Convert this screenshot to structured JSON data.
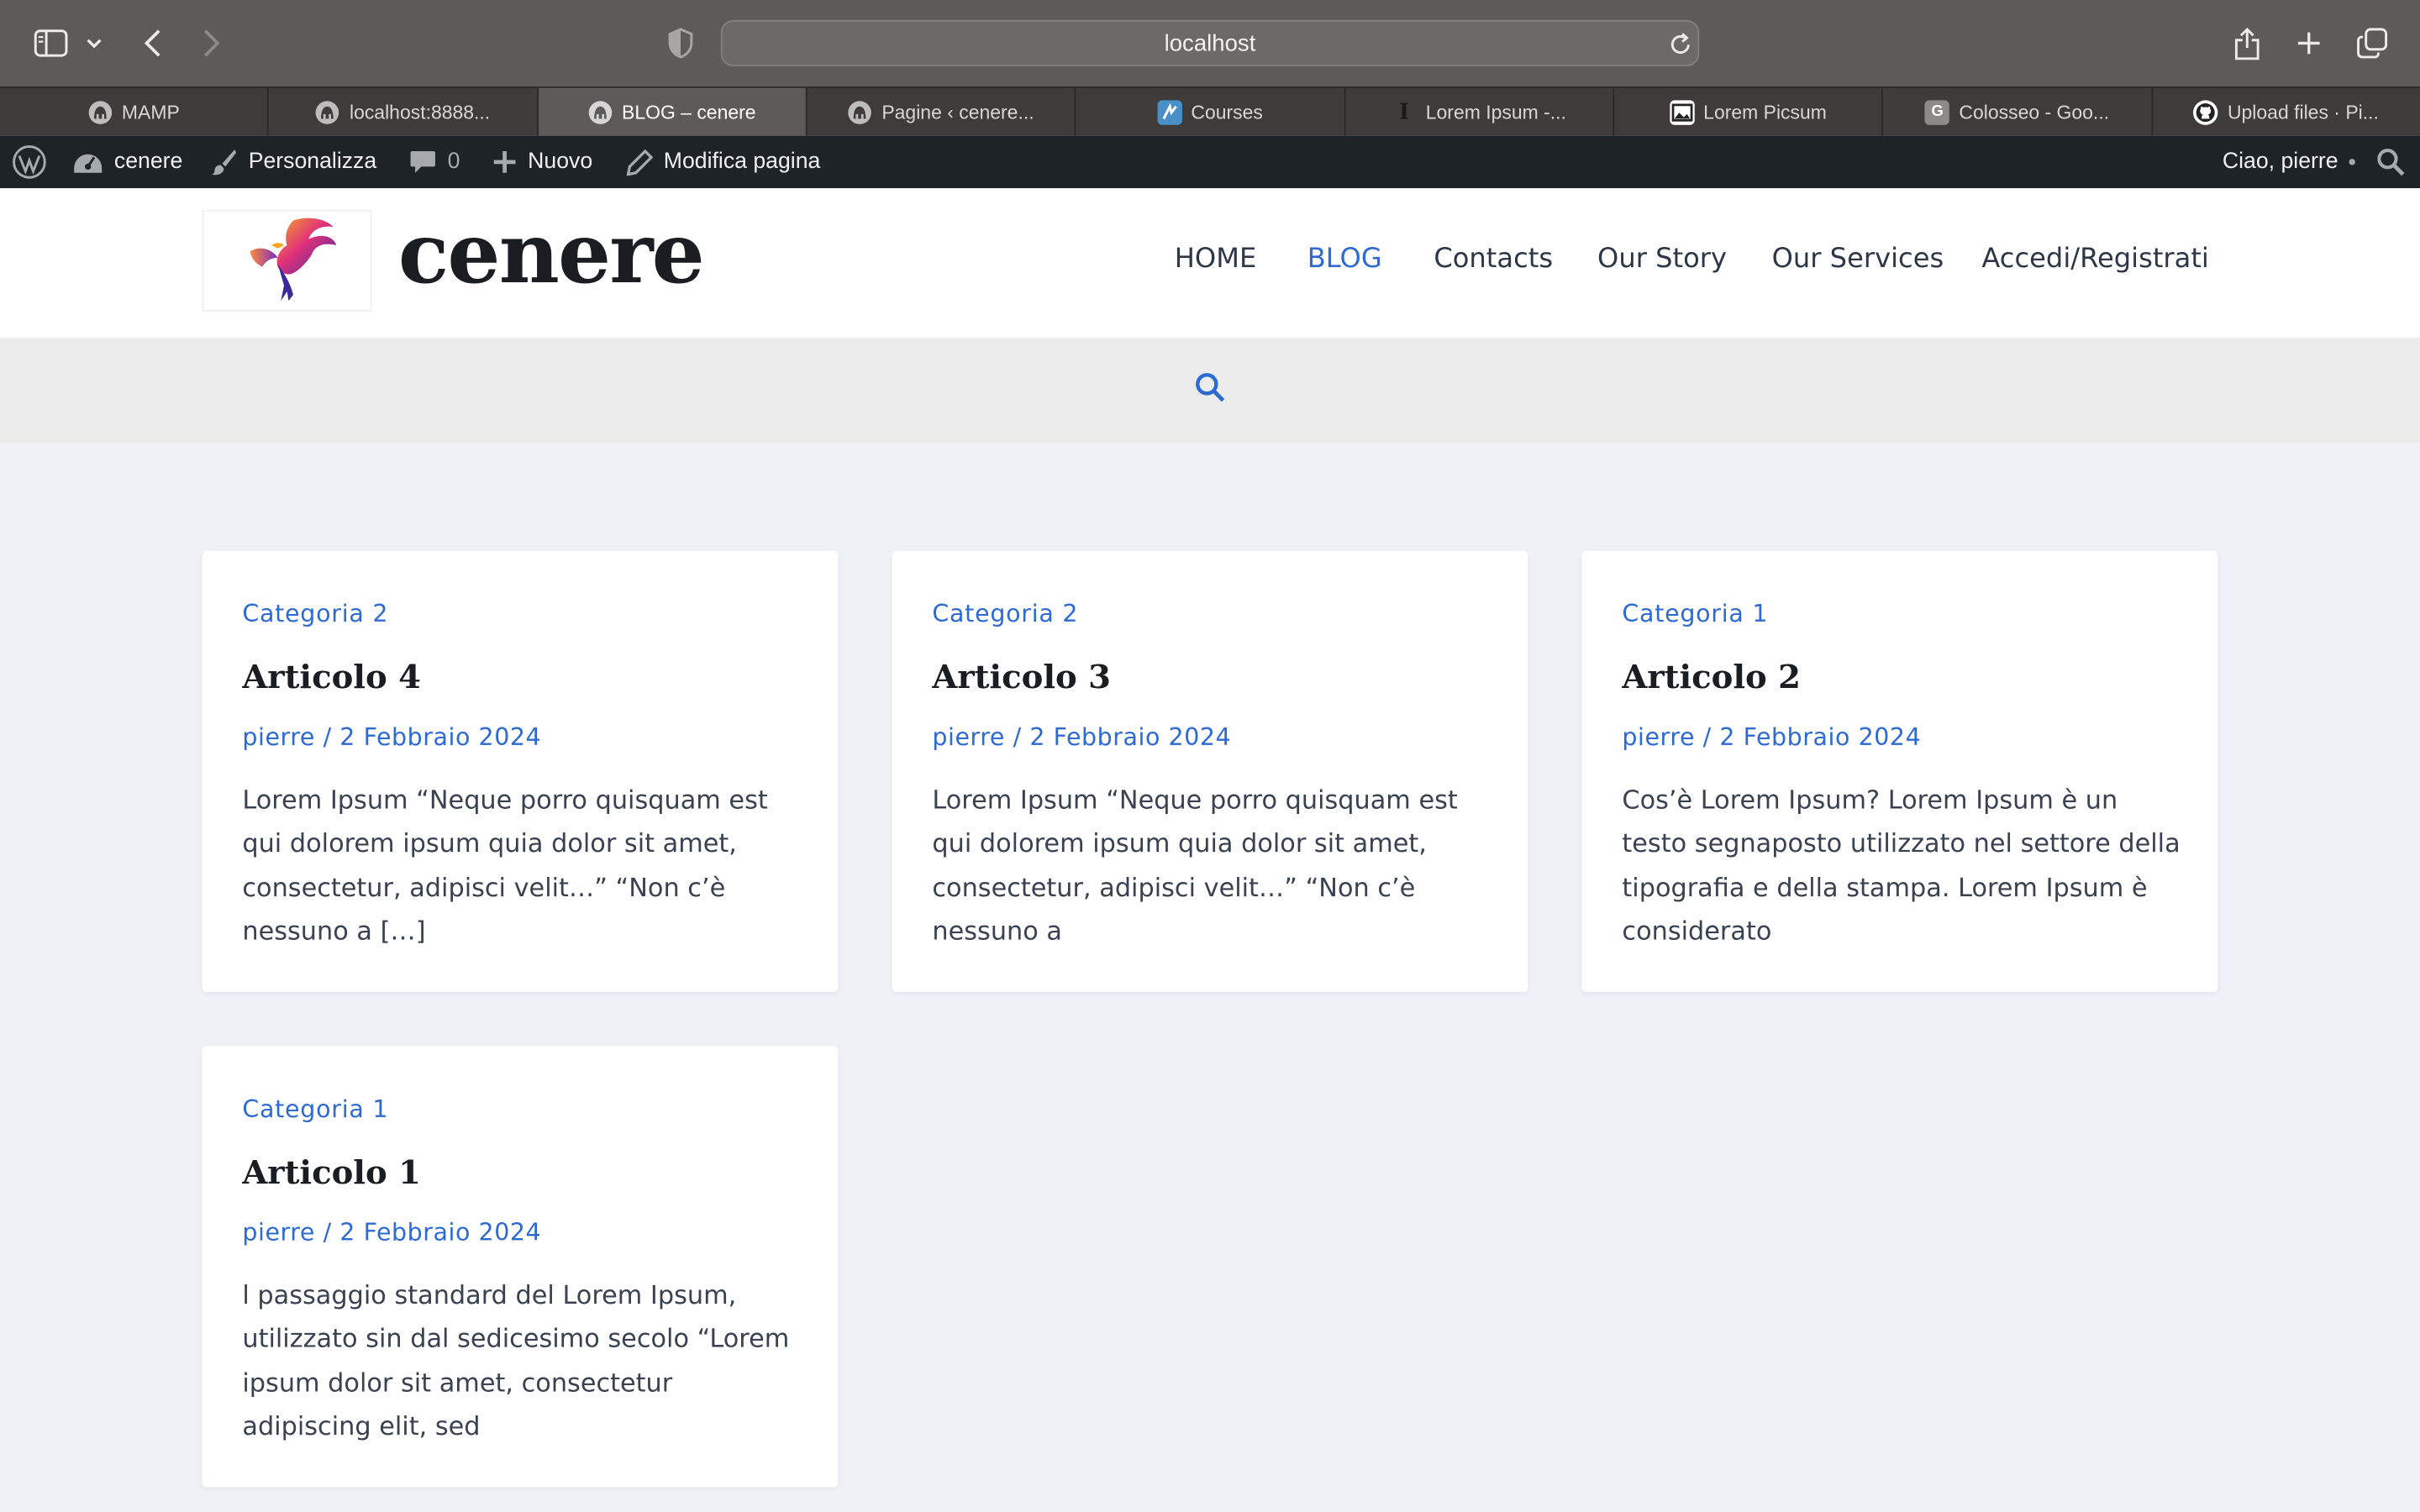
{
  "browser": {
    "url": "localhost",
    "tabs": [
      {
        "label": "MAMP",
        "icon": "mamp-elephant-icon",
        "active": false
      },
      {
        "label": "localhost:8888...",
        "icon": "mamp-elephant-icon",
        "active": false
      },
      {
        "label": "BLOG – cenere",
        "icon": "mamp-elephant-icon",
        "active": true
      },
      {
        "label": "Pagine ‹ cenere...",
        "icon": "mamp-elephant-icon",
        "active": false
      },
      {
        "label": "Courses",
        "icon": "courses-icon",
        "active": false
      },
      {
        "label": "Lorem Ipsum -...",
        "icon": "lorem-ipsum-icon",
        "active": false
      },
      {
        "label": "Lorem Picsum",
        "icon": "picsum-icon",
        "active": false
      },
      {
        "label": "Colosseo - Goo...",
        "icon": "google-g-icon",
        "active": false
      },
      {
        "label": "Upload files · Pi...",
        "icon": "github-icon",
        "active": false
      }
    ]
  },
  "adminbar": {
    "site": "cenere",
    "customize": "Personalizza",
    "comments_count": "0",
    "new": "Nuovo",
    "edit_page": "Modifica pagina",
    "greeting": "Ciao, pierre"
  },
  "site": {
    "title": "cenere",
    "nav": [
      {
        "label": "HOME",
        "active": false
      },
      {
        "label": "BLOG",
        "active": true
      },
      {
        "label": "Contacts",
        "active": false
      },
      {
        "label": "Our Story",
        "active": false
      },
      {
        "label": "Our Services",
        "active": false
      },
      {
        "label": "Accedi/Registrati",
        "active": false
      }
    ]
  },
  "posts": [
    {
      "category": "Categoria 2",
      "title": "Articolo 4",
      "meta": "pierre / 2 Febbraio 2024",
      "excerpt": "Lorem Ipsum “Neque porro quisquam est qui dolorem ipsum quia dolor sit amet, consectetur, adipisci velit…” “Non c’è nessuno a […]"
    },
    {
      "category": "Categoria 2",
      "title": "Articolo 3",
      "meta": "pierre / 2 Febbraio 2024",
      "excerpt": "Lorem Ipsum “Neque porro quisquam est qui dolorem ipsum quia dolor sit amet, consectetur, adipisci velit…” “Non c’è nessuno a"
    },
    {
      "category": "Categoria 1",
      "title": "Articolo 2",
      "meta": "pierre / 2 Febbraio 2024",
      "excerpt": "Cos’è Lorem Ipsum? Lorem Ipsum è un testo segnaposto utilizzato nel settore della tipografia e della stampa. Lorem Ipsum è considerato"
    },
    {
      "category": "Categoria 1",
      "title": "Articolo 1",
      "meta": "pierre / 2 Febbraio 2024",
      "excerpt": "l passaggio standard del Lorem Ipsum, utilizzato sin dal sedicesimo secolo “Lorem ipsum dolor sit amet, consectetur adipiscing elit, sed"
    }
  ],
  "colors": {
    "accent": "#2d6ad3",
    "admin_bar": "#1d2327",
    "page_bg": "#eef2f7",
    "toolbar": "#5e5a59"
  }
}
